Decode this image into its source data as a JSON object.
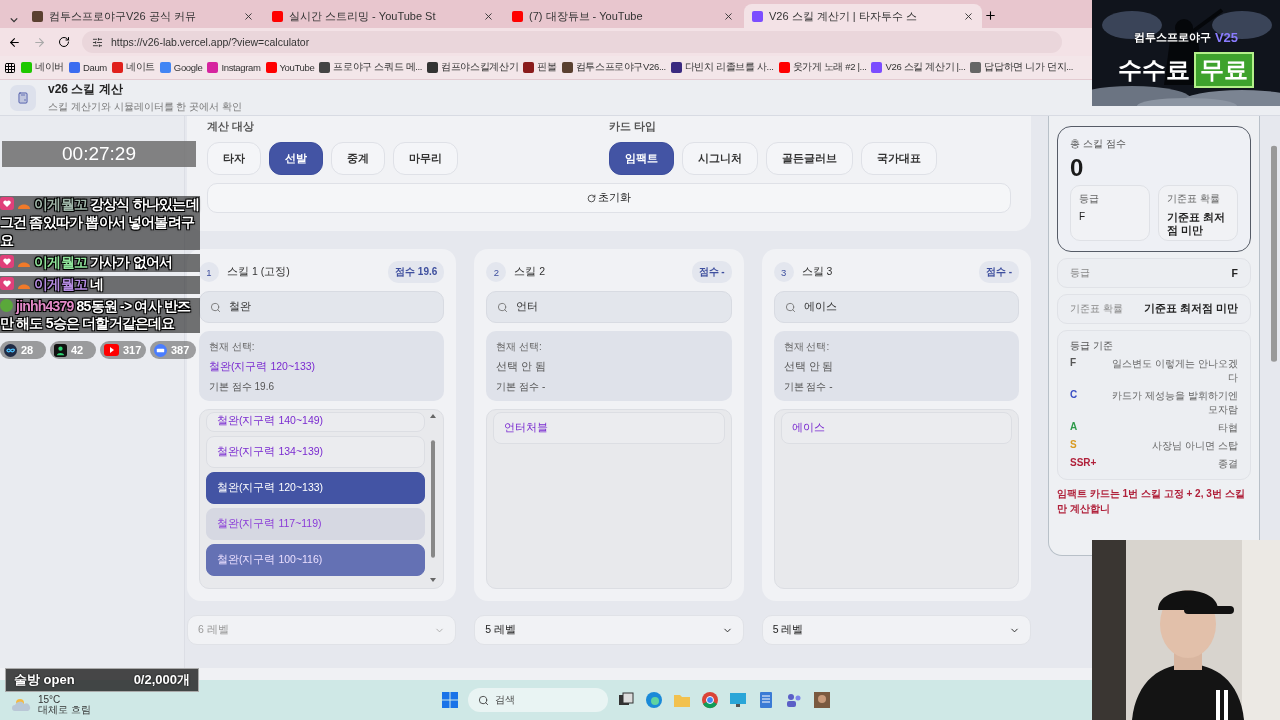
{
  "browser": {
    "tabs": [
      {
        "title": "컴투스프로야구V26 공식 커뮤",
        "selected": false
      },
      {
        "title": "실시간 스트리밍 - YouTube St",
        "selected": false
      },
      {
        "title": "(7) 대장튜브 - YouTube",
        "selected": false
      },
      {
        "title": "V26 스킬 계산기 | 타자투수 스",
        "selected": true
      }
    ],
    "url": "https://v26-lab.vercel.app/?view=calculator",
    "bookmarks": [
      {
        "label": "네이버",
        "color": "#1ec800"
      },
      {
        "label": "Daum",
        "color": "#3b6cf0"
      },
      {
        "label": "네이트",
        "color": "#e0201c"
      },
      {
        "label": "Google",
        "color": "#4285f4"
      },
      {
        "label": "Instagram",
        "color": "#d6249f"
      },
      {
        "label": "YouTube",
        "color": "#ff0000"
      },
      {
        "label": "프로야구 스쿼드 메...",
        "color": "#444444"
      },
      {
        "label": "컴프야스킬계산기",
        "color": "#333333"
      },
      {
        "label": "핀볼",
        "color": "#8a1c1c"
      },
      {
        "label": "컴투스프로야구V26...",
        "color": "#5a4030"
      },
      {
        "label": "다빈치 리졸브를 사...",
        "color": "#3a2a80"
      },
      {
        "label": "웃가게 노래 #2 |...",
        "color": "#ff0000"
      },
      {
        "label": "V26 스킬 계산기 |...",
        "color": "#7c4dff"
      },
      {
        "label": "답답하면 니가 던지...",
        "color": "#666666"
      }
    ]
  },
  "app": {
    "title": "v26 스킬 계산",
    "subtitle": "스킬 계산기와 시뮬레이터를 한 곳에서 확인"
  },
  "target": {
    "label": "계산 대상",
    "options": [
      {
        "label": "타자",
        "selected": false
      },
      {
        "label": "선발",
        "selected": true
      },
      {
        "label": "중계",
        "selected": false
      },
      {
        "label": "마무리",
        "selected": false
      }
    ]
  },
  "card_type": {
    "label": "카드 타입",
    "options": [
      {
        "label": "임팩트",
        "selected": true
      },
      {
        "label": "시그니처",
        "selected": false
      },
      {
        "label": "골든글러브",
        "selected": false
      },
      {
        "label": "국가대표",
        "selected": false
      }
    ]
  },
  "reset_button": "초기화",
  "skills": [
    {
      "number": "1",
      "title": "스킬 1 (고정)",
      "score": "점수 19.6",
      "search": "철완",
      "current_label": "현재 선택:",
      "current_name": "철완(지구력 120~133)",
      "current_chosen": true,
      "base_score": "기본 점수 19.6",
      "scrollbar": true,
      "options": [
        {
          "label": "철완(지구력 140~149)",
          "selected": false,
          "hovered": false,
          "highlighted": false
        },
        {
          "label": "철완(지구력 134~139)",
          "selected": false,
          "hovered": false,
          "highlighted": false
        },
        {
          "label": "철완(지구력 120~133)",
          "selected": true,
          "hovered": false,
          "highlighted": false
        },
        {
          "label": "철완(지구력 117~119)",
          "selected": false,
          "hovered": false,
          "highlighted": true
        },
        {
          "label": "철완(지구력 100~116)",
          "selected": false,
          "hovered": true,
          "highlighted": false
        }
      ],
      "level": {
        "value": "6 레벨",
        "disabled": true
      }
    },
    {
      "number": "2",
      "title": "스킬 2",
      "score": "점수 -",
      "search": "언터",
      "current_label": "현재 선택:",
      "current_name": "선택 안 됨",
      "current_chosen": false,
      "base_score": "기본 점수 -",
      "scrollbar": false,
      "options": [
        {
          "label": "언터처블",
          "selected": false,
          "hovered": false,
          "highlighted": false
        }
      ],
      "level": {
        "value": "5 레벨",
        "disabled": false
      }
    },
    {
      "number": "3",
      "title": "스킬 3",
      "score": "점수 -",
      "search": "에이스",
      "current_label": "현재 선택:",
      "current_name": "선택 안 됨",
      "current_chosen": false,
      "base_score": "기본 점수 -",
      "scrollbar": false,
      "options": [
        {
          "label": "에이스",
          "selected": false,
          "hovered": false,
          "highlighted": false
        }
      ],
      "level": {
        "value": "5 레벨",
        "disabled": false
      }
    }
  ],
  "summary": {
    "label": "총 스킬 점수",
    "value": "0",
    "boxes": [
      {
        "label": "등급",
        "value": "F"
      },
      {
        "label": "기준표 확률",
        "value": "기준표 최저점 미만"
      }
    ]
  },
  "rows": [
    {
      "label": "등급",
      "value": "F"
    },
    {
      "label": "기준표 확률",
      "value": "기준표 최저점 미만"
    }
  ],
  "legend": {
    "title": "등급 기준",
    "items": [
      {
        "grade": "F",
        "color": "#555555",
        "text": "일스변도 이렇게는 안나오겠다"
      },
      {
        "grade": "C",
        "color": "#3b4fc4",
        "text": "카드가 제성능을 발휘하기엔 모자람"
      },
      {
        "grade": "A",
        "color": "#2e9a4a",
        "text": "타협"
      },
      {
        "grade": "S",
        "color": "#d89a20",
        "text": "사장님 아니면 스탑"
      },
      {
        "grade": "SSR+",
        "color": "#b0203a",
        "text": "종결"
      }
    ]
  },
  "note": "임팩트 카드는 1번 스킬 고정 + 2, 3번 스킬만 계산합니",
  "stream": {
    "timer": "00:27:29",
    "chat": [
      {
        "user": "이게뭘꼬",
        "color": "#9fb5a8",
        "kind": "heart",
        "text": "강상식 하나있는데 그건 좀있따가 뽑아서 넣어볼려구요"
      },
      {
        "user": "이게뭘꼬",
        "color": "#8fe39a",
        "kind": "heart",
        "text": "가사가 없어서"
      },
      {
        "user": "이게뭘꼬",
        "color": "#b48be0",
        "kind": "heart",
        "text": "네"
      },
      {
        "user": "jinhh4379",
        "color": "#e48ac8",
        "kind": "dot",
        "text": "85동원 -> 여사 반즈만 해도 5승은 더할거같은데요"
      }
    ],
    "counters": [
      {
        "kind": "loop",
        "value": "28"
      },
      {
        "kind": "person",
        "value": "42"
      },
      {
        "kind": "play",
        "value": "317"
      },
      {
        "kind": "chat",
        "value": "387"
      }
    ],
    "goal_label": "술방 open",
    "goal_value": "0/2,000개",
    "banner_brand": "컴투스프로야구",
    "banner_version": "V25",
    "banner_text": "수수료",
    "banner_badge": "무료"
  },
  "taskbar": {
    "temp": "15°C",
    "weather": "대체로 흐림",
    "search": "검색"
  }
}
